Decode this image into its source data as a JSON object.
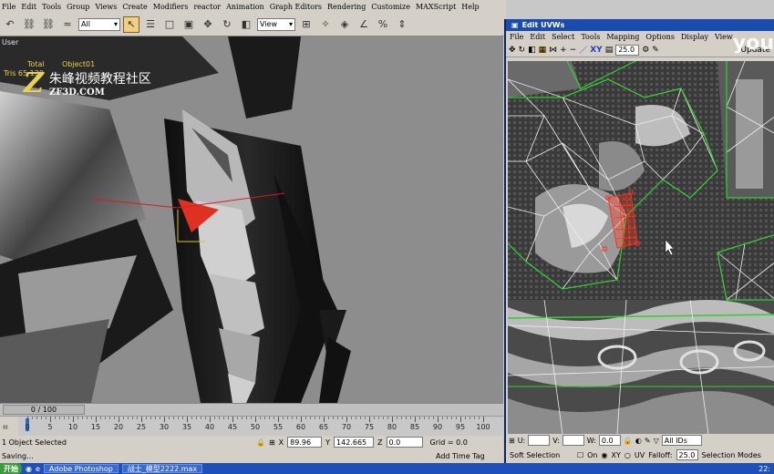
{
  "menu": [
    "File",
    "Edit",
    "Tools",
    "Group",
    "Views",
    "Create",
    "Modifiers",
    "reactor",
    "Animation",
    "Graph Editors",
    "Rendering",
    "Customize",
    "MAXScript",
    "Help"
  ],
  "toolbar": {
    "filter": "All",
    "refcoord": "View"
  },
  "viewport": {
    "label": "User",
    "stats_total": "Total",
    "stats_object": "Object01",
    "stats_tris": "Tris 65 130",
    "logo_cn": "朱峰视频教程社区",
    "logo_url": "ZF3D.COM"
  },
  "timeslider": {
    "frame": "0 / 100"
  },
  "trackbar": {
    "ticks": [
      "0",
      "5",
      "10",
      "15",
      "20",
      "25",
      "30",
      "35",
      "40",
      "45",
      "50",
      "55",
      "60",
      "65",
      "70",
      "75",
      "80",
      "85",
      "90",
      "95",
      "100"
    ]
  },
  "status": {
    "selected": "1 Object Selected",
    "x": "89.96",
    "y": "142.665",
    "z": "0.0",
    "grid": "Grid = 0.0"
  },
  "prompt": {
    "text": "Saving...",
    "tag": "Add Time Tag"
  },
  "taskbar": {
    "start": "开始",
    "items": [
      "Adobe Photoshop",
      "战士_模型2222.max"
    ],
    "clock": "22:"
  },
  "uvw": {
    "title": "Edit UVWs",
    "menu": [
      "File",
      "Edit",
      "Select",
      "Tools",
      "Mapping",
      "Options",
      "Display",
      "View"
    ],
    "axis": "XY",
    "zoom": "25.0",
    "update": "Update",
    "u_label": "U:",
    "v_label": "V:",
    "w_label": "W:",
    "w_value": "0.0",
    "ids": "All IDs",
    "soft_selection": "Soft Selection",
    "on": "On",
    "xy": "XY",
    "uv": "UV",
    "falloff": "Falloff:",
    "falloff_value": "25.0",
    "selection_modes": "Selection Modes"
  },
  "watermark": "you"
}
